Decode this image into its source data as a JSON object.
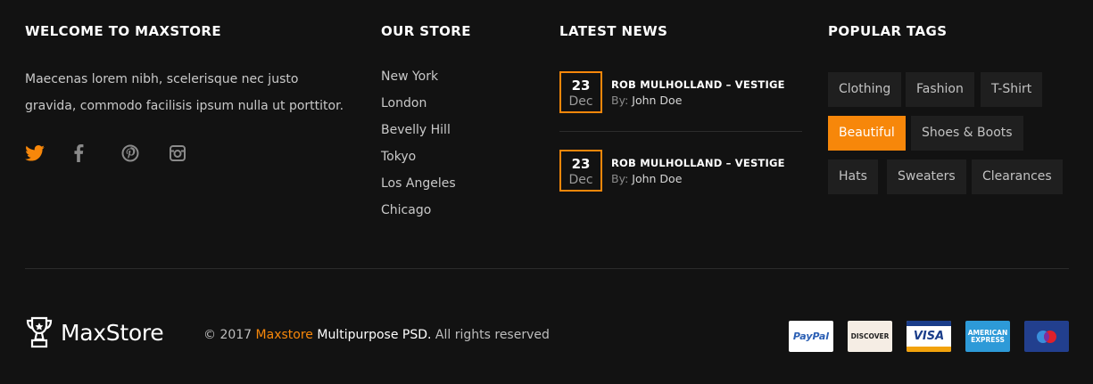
{
  "welcome": {
    "heading": "WELCOME TO MAXSTORE",
    "text": "Maecenas lorem nibh, scelerisque nec justo gravida, commodo facilisis ipsum nulla ut porttitor.",
    "social": [
      {
        "icon": "twitter-icon",
        "color": "#f7870a"
      },
      {
        "icon": "facebook-icon",
        "color": "#8a8a8a"
      },
      {
        "icon": "pinterest-icon",
        "color": "#8a8a8a"
      },
      {
        "icon": "instagram-icon",
        "color": "#8a8a8a"
      }
    ]
  },
  "store": {
    "heading": "OUR STORE",
    "locations": [
      "New York",
      "London",
      "Bevelly Hill",
      "Tokyo",
      "Los Angeles",
      "Chicago"
    ]
  },
  "news": {
    "heading": "LATEST NEWS",
    "items": [
      {
        "day": "23",
        "month": "Dec",
        "title": "ROB MULHOLLAND – VESTIGE",
        "by": "By:",
        "author": "John Doe"
      },
      {
        "day": "23",
        "month": "Dec",
        "title": "ROB MULHOLLAND – VESTIGE",
        "by": "By:",
        "author": "John Doe"
      }
    ]
  },
  "tags": {
    "heading": "POPULAR TAGS",
    "items": [
      "Clothing",
      "Fashion",
      "T-Shirt",
      "Beautiful",
      "Shoes & Boots",
      "Hats",
      "Sweaters",
      "Clearances"
    ],
    "active": "Beautiful"
  },
  "footer": {
    "brand": "MaxStore",
    "copyright_prefix": "© 2017",
    "copyright_brand": "Maxstore",
    "copyright_product": "Multipurpose PSD.",
    "copyright_suffix": "All rights reserved",
    "payments": [
      {
        "name": "PayPal",
        "label": "PayPal"
      },
      {
        "name": "Discover",
        "label": "DISCOVER"
      },
      {
        "name": "Visa",
        "label": "VISA"
      },
      {
        "name": "American Express",
        "label": "AMERICAN EXPRESS"
      },
      {
        "name": "Maestro",
        "label": ""
      }
    ]
  },
  "colors": {
    "accent": "#f7870a",
    "background": "#121212",
    "tag_bg": "#1f1f1f"
  }
}
